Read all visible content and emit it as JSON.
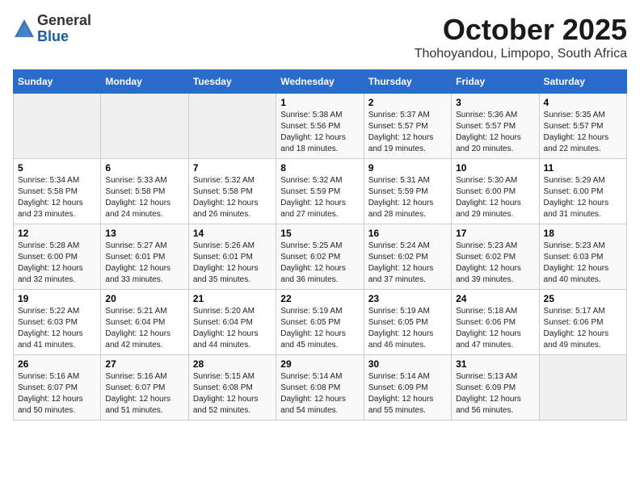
{
  "header": {
    "logo_general": "General",
    "logo_blue": "Blue",
    "month_title": "October 2025",
    "location": "Thohoyandou, Limpopo, South Africa"
  },
  "days_of_week": [
    "Sunday",
    "Monday",
    "Tuesday",
    "Wednesday",
    "Thursday",
    "Friday",
    "Saturday"
  ],
  "weeks": [
    [
      {
        "day": "",
        "info": ""
      },
      {
        "day": "",
        "info": ""
      },
      {
        "day": "",
        "info": ""
      },
      {
        "day": "1",
        "info": "Sunrise: 5:38 AM\nSunset: 5:56 PM\nDaylight: 12 hours\nand 18 minutes."
      },
      {
        "day": "2",
        "info": "Sunrise: 5:37 AM\nSunset: 5:57 PM\nDaylight: 12 hours\nand 19 minutes."
      },
      {
        "day": "3",
        "info": "Sunrise: 5:36 AM\nSunset: 5:57 PM\nDaylight: 12 hours\nand 20 minutes."
      },
      {
        "day": "4",
        "info": "Sunrise: 5:35 AM\nSunset: 5:57 PM\nDaylight: 12 hours\nand 22 minutes."
      }
    ],
    [
      {
        "day": "5",
        "info": "Sunrise: 5:34 AM\nSunset: 5:58 PM\nDaylight: 12 hours\nand 23 minutes."
      },
      {
        "day": "6",
        "info": "Sunrise: 5:33 AM\nSunset: 5:58 PM\nDaylight: 12 hours\nand 24 minutes."
      },
      {
        "day": "7",
        "info": "Sunrise: 5:32 AM\nSunset: 5:58 PM\nDaylight: 12 hours\nand 26 minutes."
      },
      {
        "day": "8",
        "info": "Sunrise: 5:32 AM\nSunset: 5:59 PM\nDaylight: 12 hours\nand 27 minutes."
      },
      {
        "day": "9",
        "info": "Sunrise: 5:31 AM\nSunset: 5:59 PM\nDaylight: 12 hours\nand 28 minutes."
      },
      {
        "day": "10",
        "info": "Sunrise: 5:30 AM\nSunset: 6:00 PM\nDaylight: 12 hours\nand 29 minutes."
      },
      {
        "day": "11",
        "info": "Sunrise: 5:29 AM\nSunset: 6:00 PM\nDaylight: 12 hours\nand 31 minutes."
      }
    ],
    [
      {
        "day": "12",
        "info": "Sunrise: 5:28 AM\nSunset: 6:00 PM\nDaylight: 12 hours\nand 32 minutes."
      },
      {
        "day": "13",
        "info": "Sunrise: 5:27 AM\nSunset: 6:01 PM\nDaylight: 12 hours\nand 33 minutes."
      },
      {
        "day": "14",
        "info": "Sunrise: 5:26 AM\nSunset: 6:01 PM\nDaylight: 12 hours\nand 35 minutes."
      },
      {
        "day": "15",
        "info": "Sunrise: 5:25 AM\nSunset: 6:02 PM\nDaylight: 12 hours\nand 36 minutes."
      },
      {
        "day": "16",
        "info": "Sunrise: 5:24 AM\nSunset: 6:02 PM\nDaylight: 12 hours\nand 37 minutes."
      },
      {
        "day": "17",
        "info": "Sunrise: 5:23 AM\nSunset: 6:02 PM\nDaylight: 12 hours\nand 39 minutes."
      },
      {
        "day": "18",
        "info": "Sunrise: 5:23 AM\nSunset: 6:03 PM\nDaylight: 12 hours\nand 40 minutes."
      }
    ],
    [
      {
        "day": "19",
        "info": "Sunrise: 5:22 AM\nSunset: 6:03 PM\nDaylight: 12 hours\nand 41 minutes."
      },
      {
        "day": "20",
        "info": "Sunrise: 5:21 AM\nSunset: 6:04 PM\nDaylight: 12 hours\nand 42 minutes."
      },
      {
        "day": "21",
        "info": "Sunrise: 5:20 AM\nSunset: 6:04 PM\nDaylight: 12 hours\nand 44 minutes."
      },
      {
        "day": "22",
        "info": "Sunrise: 5:19 AM\nSunset: 6:05 PM\nDaylight: 12 hours\nand 45 minutes."
      },
      {
        "day": "23",
        "info": "Sunrise: 5:19 AM\nSunset: 6:05 PM\nDaylight: 12 hours\nand 46 minutes."
      },
      {
        "day": "24",
        "info": "Sunrise: 5:18 AM\nSunset: 6:06 PM\nDaylight: 12 hours\nand 47 minutes."
      },
      {
        "day": "25",
        "info": "Sunrise: 5:17 AM\nSunset: 6:06 PM\nDaylight: 12 hours\nand 49 minutes."
      }
    ],
    [
      {
        "day": "26",
        "info": "Sunrise: 5:16 AM\nSunset: 6:07 PM\nDaylight: 12 hours\nand 50 minutes."
      },
      {
        "day": "27",
        "info": "Sunrise: 5:16 AM\nSunset: 6:07 PM\nDaylight: 12 hours\nand 51 minutes."
      },
      {
        "day": "28",
        "info": "Sunrise: 5:15 AM\nSunset: 6:08 PM\nDaylight: 12 hours\nand 52 minutes."
      },
      {
        "day": "29",
        "info": "Sunrise: 5:14 AM\nSunset: 6:08 PM\nDaylight: 12 hours\nand 54 minutes."
      },
      {
        "day": "30",
        "info": "Sunrise: 5:14 AM\nSunset: 6:09 PM\nDaylight: 12 hours\nand 55 minutes."
      },
      {
        "day": "31",
        "info": "Sunrise: 5:13 AM\nSunset: 6:09 PM\nDaylight: 12 hours\nand 56 minutes."
      },
      {
        "day": "",
        "info": ""
      }
    ]
  ]
}
